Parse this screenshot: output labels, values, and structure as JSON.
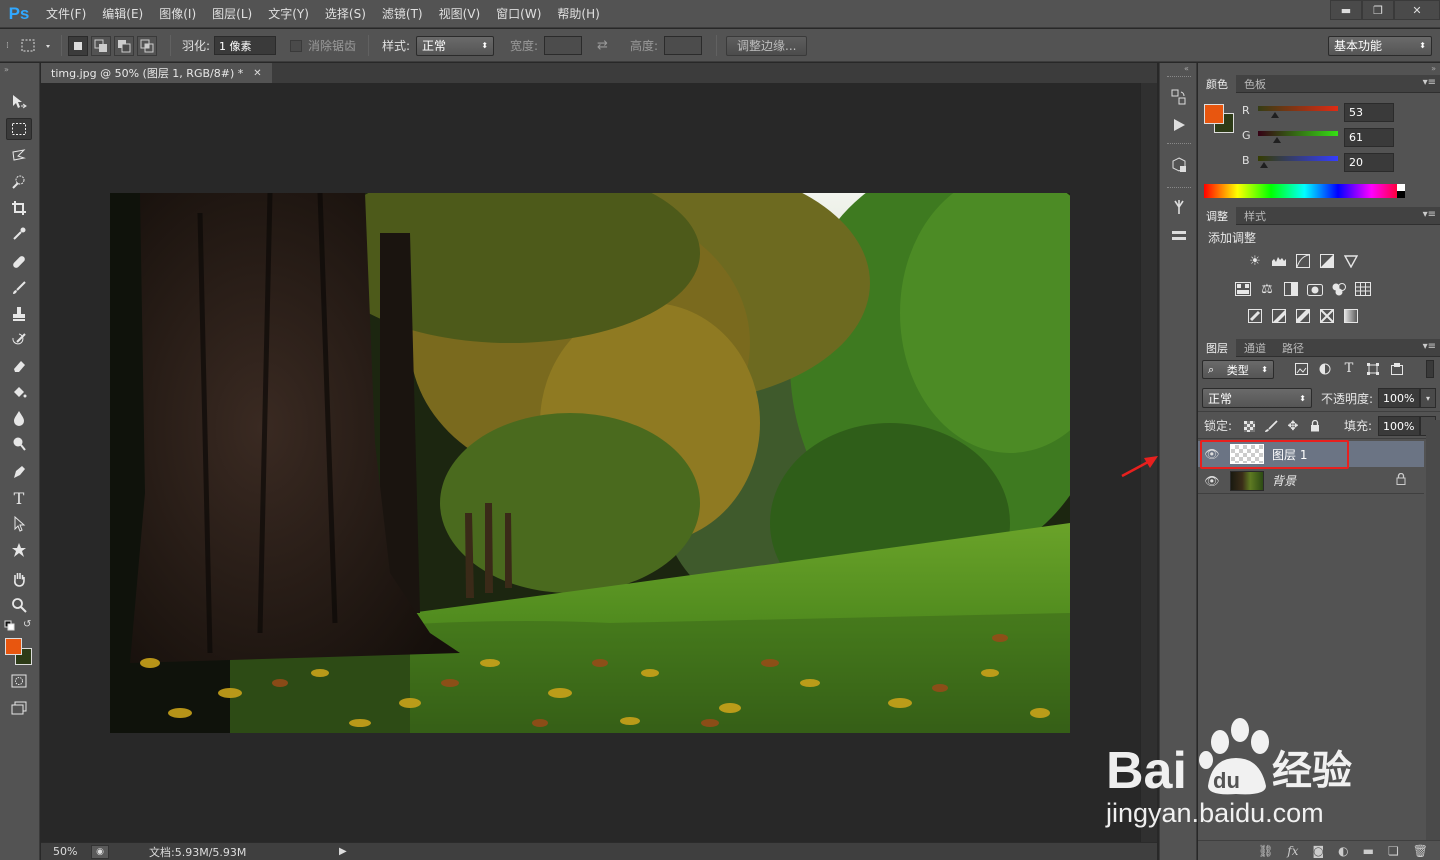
{
  "app": {
    "logo": "Ps"
  },
  "menu": [
    "文件(F)",
    "编辑(E)",
    "图像(I)",
    "图层(L)",
    "文字(Y)",
    "选择(S)",
    "滤镜(T)",
    "视图(V)",
    "窗口(W)",
    "帮助(H)"
  ],
  "window_controls": {
    "minimize": "▬",
    "restore": "❐",
    "close": "✕"
  },
  "options": {
    "feather_label": "羽化:",
    "feather_value": "1 像素",
    "antialias_label": "消除锯齿",
    "style_label": "样式:",
    "style_value": "正常",
    "width_label": "宽度:",
    "height_label": "高度:",
    "refine_edge": "调整边缘...",
    "workspace": "基本功能"
  },
  "document": {
    "tab_title": "timg.jpg @ 50% (图层 1, RGB/8#) *",
    "zoom": "50%",
    "doc_info": "文档:5.93M/5.93M"
  },
  "color_panel": {
    "tabs": [
      "颜色",
      "色板"
    ],
    "foreground": "#e8560f",
    "background": "#2d3b17",
    "r_label": "R",
    "r_value": "53",
    "g_label": "G",
    "g_value": "61",
    "b_label": "B",
    "b_value": "20"
  },
  "adjustments_panel": {
    "tabs": [
      "调整",
      "样式"
    ],
    "heading": "添加调整"
  },
  "layers_panel": {
    "tabs": [
      "图层",
      "通道",
      "路径"
    ],
    "filter_kind": "类型",
    "blend_mode": "正常",
    "opacity_label": "不透明度:",
    "opacity_value": "100%",
    "lock_label": "锁定:",
    "fill_label": "填充:",
    "fill_value": "100%",
    "layers": [
      {
        "name": "图层 1",
        "selected": true
      },
      {
        "name": "背景",
        "selected": false,
        "locked": true
      }
    ]
  },
  "watermark": {
    "brand": "Bai",
    "brand_cn": "经验",
    "url": "jingyan.baidu.com"
  },
  "highlight_color": "#e8201e"
}
